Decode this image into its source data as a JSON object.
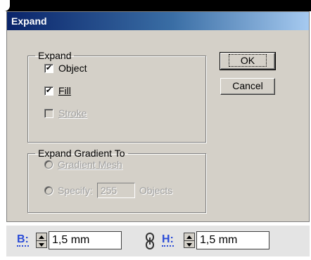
{
  "dialog": {
    "title": "Expand",
    "expand_group": {
      "legend": "Expand",
      "object": {
        "label": "Object",
        "checked": true,
        "enabled": true
      },
      "fill": {
        "label": "Fill",
        "checked": true,
        "enabled": true
      },
      "stroke": {
        "label": "Stroke",
        "checked": false,
        "enabled": false
      }
    },
    "gradient_group": {
      "legend": "Expand Gradient To",
      "gradient_mesh": {
        "label": "Gradient Mesh",
        "enabled": false
      },
      "specify": {
        "label": "Specify:",
        "value": "255",
        "suffix": "Objects",
        "enabled": false
      }
    },
    "buttons": {
      "ok": "OK",
      "cancel": "Cancel"
    }
  },
  "toolbar": {
    "b_label": "B:",
    "b_value": "1,5 mm",
    "h_label": "H:",
    "h_value": "1,5 mm"
  },
  "icons": [
    "chain-link-icon",
    "spinner-arrows-icon",
    "checkmark-icon"
  ],
  "colors": {
    "title_gradient_start": "#0a246a",
    "title_gradient_end": "#a6caf0",
    "dialog_face": "#d4d0c8",
    "field_label_blue": "#2a4bd7"
  }
}
